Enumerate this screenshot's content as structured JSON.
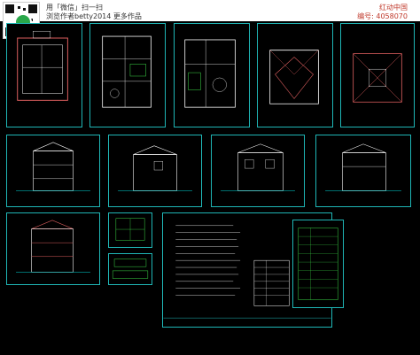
{
  "header": {
    "line1": "用「微信」扫一扫",
    "line2": "浏览作者betty2014 更多作品",
    "site": "红动中国",
    "id_label": "编号: 4058070"
  },
  "colors": {
    "frame": "#1fb6b6",
    "line": "#ffffff",
    "accent": "#00e0e0",
    "roof": "#e06060",
    "green": "#3fe04a",
    "text": "#c0392b"
  },
  "icons": {
    "qr": "qr-code-icon",
    "wechat": "wechat-logo-icon"
  }
}
